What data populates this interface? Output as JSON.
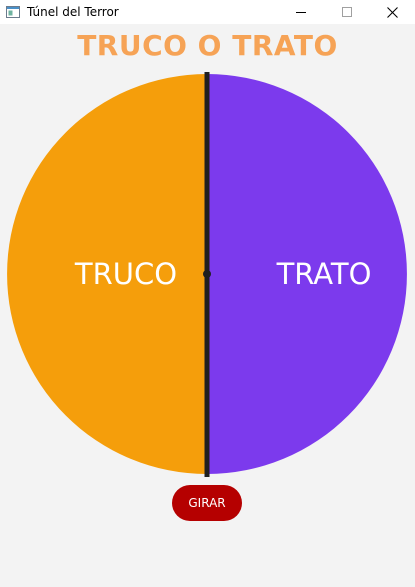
{
  "window": {
    "title": "Túnel del Terror",
    "icon": "app-window-icon",
    "controls": [
      "minimize-icon",
      "maximize-icon",
      "close-icon"
    ]
  },
  "main": {
    "heading": "TRUCO O TRATO",
    "wheel": {
      "segments": [
        {
          "label": "TRUCO",
          "color": "#f59e0b"
        },
        {
          "label": "TRATO",
          "color": "#7c3aed"
        }
      ],
      "pointer_color": "#1f1f1f"
    },
    "spin_button_label": "GIRAR"
  },
  "colors": {
    "heading": "#f6a356",
    "background": "#f3f3f3",
    "spin_button": "#b50000"
  }
}
